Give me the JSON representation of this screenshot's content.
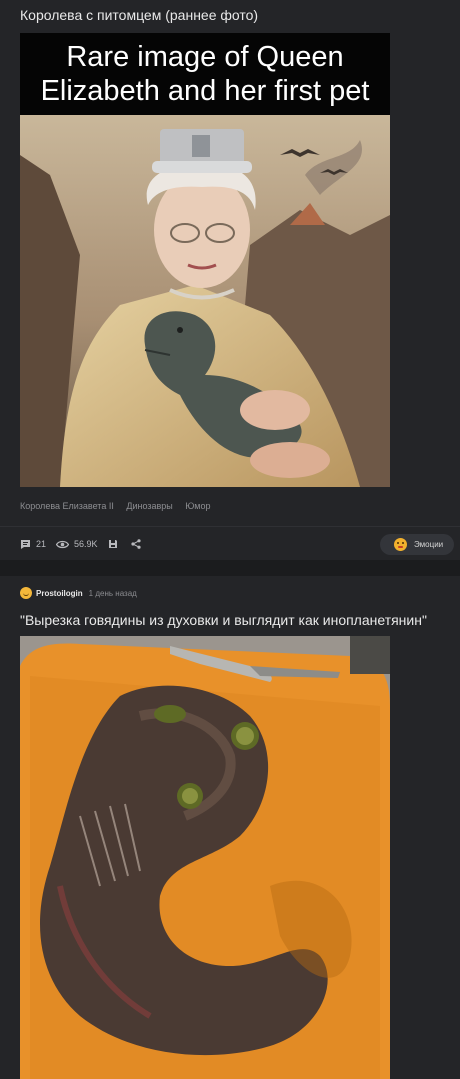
{
  "post1": {
    "title": "Королева с питомцем (раннее фото)",
    "image": {
      "caption_line1": "Rare image of Queen",
      "caption_line2": "Elizabeth and her first pet"
    },
    "tags": [
      "Королева Елизавета II",
      "Динозавры",
      "Юмор"
    ],
    "stats": {
      "comments": "21",
      "views": "56.9K"
    },
    "emotions_label": "Эмоции",
    "icons": [
      "comment-icon",
      "eye-icon",
      "save-icon",
      "share-icon"
    ]
  },
  "post2": {
    "author": "Prostoilogin",
    "time": "1 день назад",
    "title": "\"Вырезка говядины  из духовки и выглядит как инопланетянин\""
  },
  "colors": {
    "background": "#1b1c1e",
    "card": "#242528",
    "accent": "#f2b12d"
  }
}
